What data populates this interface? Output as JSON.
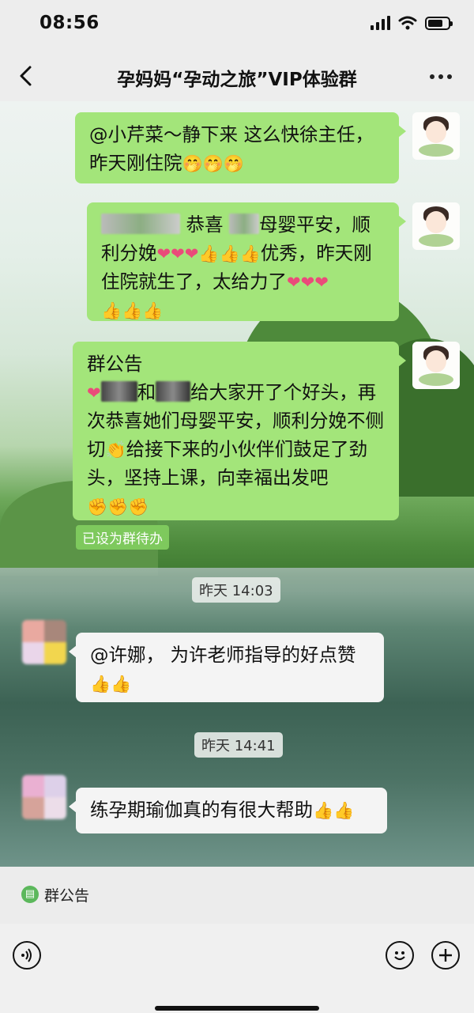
{
  "status": {
    "time": "08:56"
  },
  "header": {
    "title": "孕妈妈“孕动之旅”VIP体验群"
  },
  "messages": {
    "m1": {
      "text": "@小芹菜～静下来 这么快徐主任，昨天刚住院",
      "emoji": "🤭🤭🤭"
    },
    "m2": {
      "t1": "恭喜",
      "t2": "母婴平安，顺利分娩",
      "e1": "❤❤❤",
      "e2": "👍👍👍",
      "t3": "优秀，昨天刚住院就生了，太给力了",
      "e3": "❤❤",
      "e4": "❤",
      "e5": "👍👍👍"
    },
    "m3": {
      "title": "群公告",
      "e1": "❤",
      "t1": "和",
      "t2": "给大家开了个好头，再次恭喜她们母婴平安，顺利分娩不侧切",
      "e2": "👏",
      "t3": "给接下来的小伙伴们鼓足了劲头，坚持上课，向幸福出发吧",
      "e3": "✊✊✊"
    },
    "todo_tag": "已设为群待办",
    "time1": "昨天 14:03",
    "m4": {
      "text": "@许娜， 为许老师指导的好点赞",
      "emoji": "👍👍"
    },
    "time2": "昨天 14:41",
    "m5": {
      "text": "练孕期瑜伽真的有很大帮助",
      "emoji": "👍👍"
    }
  },
  "bottom": {
    "announcement_label": "群公告"
  },
  "icons": [
    "back-arrow-icon",
    "more-dots-icon",
    "voice-icon",
    "emoji-icon",
    "plus-icon",
    "announcement-icon"
  ],
  "colors": {
    "bubble_self": "#a3e57a",
    "bubble_other": "#f4f4f4",
    "tag": "#7ec95d"
  }
}
